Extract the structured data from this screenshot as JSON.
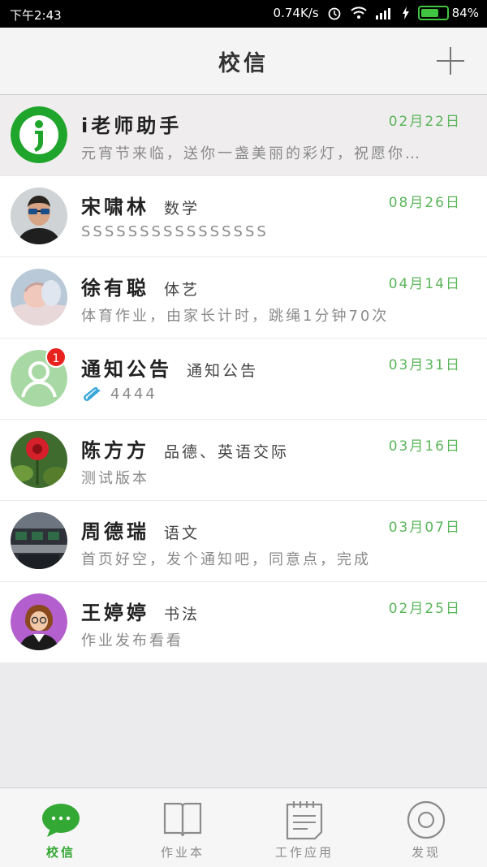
{
  "status_bar": {
    "time": "下午2:43",
    "speed": "0.74K/s",
    "battery_text": "84%",
    "battery_level": 0.84
  },
  "header": {
    "title": "校信"
  },
  "colors": {
    "accent": "#5bb55b",
    "badge": "#e8231f"
  },
  "conversations": [
    {
      "name": "i老师助手",
      "subject": "",
      "date": "02月22日",
      "preview": "元宵节来临，送你一盏美丽的彩灯，祝愿你…",
      "avatar": "assistant-logo"
    },
    {
      "name": "宋啸林",
      "subject": "数学",
      "date": "08月26日",
      "preview": "SSSSSSSSSSSSSSSS",
      "avatar": "man-sunglasses-photo"
    },
    {
      "name": "徐有聪",
      "subject": "体艺",
      "date": "04月14日",
      "preview": "体育作业，由家长计时，跳绳1分钟70次",
      "avatar": "baby-photo"
    },
    {
      "name": "通知公告",
      "subject": "通知公告",
      "date": "03月31日",
      "preview": "4444",
      "badge": "1",
      "avatar": "default-user-avatar",
      "icon": "paperclip-icon"
    },
    {
      "name": "陈方方",
      "subject": "品德、英语交际",
      "date": "03月16日",
      "preview": "测试版本",
      "avatar": "flower-photo"
    },
    {
      "name": "周德瑞",
      "subject": "语文",
      "date": "03月07日",
      "preview": "首页好空，发个通知吧，同意点，完成",
      "avatar": "office-photo"
    },
    {
      "name": "王婷婷",
      "subject": "书法",
      "date": "02月25日",
      "preview": "作业发布看看",
      "avatar": "teacher-cartoon"
    }
  ],
  "tabs": [
    {
      "label": "校信",
      "icon": "chat-bubble-icon",
      "active": true
    },
    {
      "label": "作业本",
      "icon": "book-icon"
    },
    {
      "label": "工作应用",
      "icon": "notepad-icon"
    },
    {
      "label": "发现",
      "icon": "eye-icon"
    }
  ]
}
